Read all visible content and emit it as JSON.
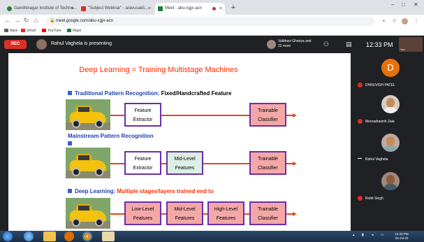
{
  "browser": {
    "tabs": [
      {
        "label": "Gandhinagar Institute of Techno...",
        "favicon_color": "#2e7d32"
      },
      {
        "label": "\"Subject Webinar\" - aravusaidi...",
        "favicon_color": "#d93025"
      },
      {
        "label": "Meet - abu-xgjx-acn",
        "favicon_color": "#188038"
      }
    ],
    "new_tab": "+",
    "address": "meet.google.com/abu-xgjx-acn",
    "bookmarks": [
      {
        "label": "Apps",
        "color": "#5f6368"
      },
      {
        "label": "Gmail",
        "color": "#d93025"
      },
      {
        "label": "YouTube",
        "color": "#ff0000"
      },
      {
        "label": "Maps",
        "color": "#188038"
      }
    ]
  },
  "meet": {
    "rec_label": "REC",
    "presenter_text": "Rahul Vaghela is presenting",
    "others_text": "Vaibhavi Ghariya and 22 more",
    "time": "12:33 PM",
    "self_label": "You"
  },
  "slide": {
    "title": "Deep Learning = Training Multistage Machines",
    "sections": [
      {
        "label": "Traditional Pattern Recognition:",
        "suffix": "Fixed/Handcrafted Feature",
        "boxes": [
          "Feature Extractor",
          "Trainable Classifier"
        ]
      },
      {
        "label": "Mainstream Pattern Recognition",
        "suffix": "",
        "boxes": [
          "Feature Extractor",
          "Mid-Level Features",
          "Trainable Classifier"
        ]
      },
      {
        "label": "Deep Learning:",
        "suffix": "Multiple stages/layers trained end to",
        "boxes": [
          "Low-Level Features",
          "Mid-Level Features",
          "High-Level Features",
          "Trainable Classifier"
        ]
      }
    ]
  },
  "participants": [
    {
      "initial": "D",
      "name": "DHRUVISH PATEL",
      "muted": true
    },
    {
      "initial": "",
      "name": "Meeradrasinh Zala",
      "muted": true
    },
    {
      "initial": "",
      "name": "Rahul Vaghela",
      "muted": false
    },
    {
      "initial": "",
      "name": "Rohit Singh",
      "muted": true
    }
  ],
  "taskbar": {
    "time": "12:33 PM",
    "date": "28-Jul-20"
  }
}
